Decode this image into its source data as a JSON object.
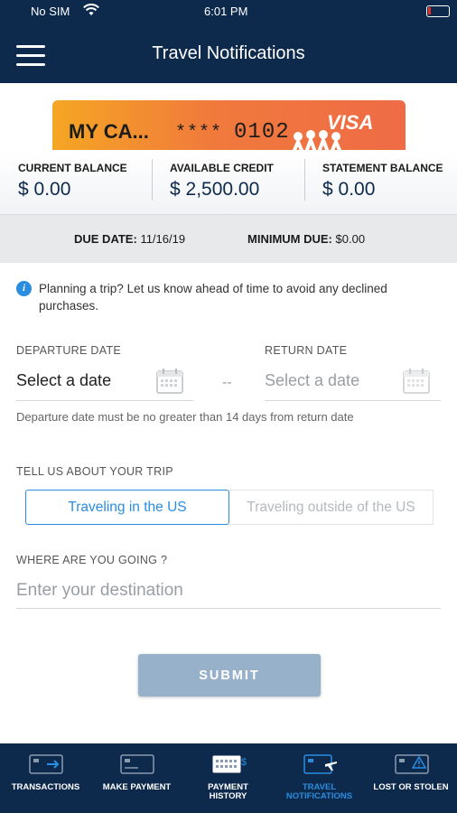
{
  "status_bar": {
    "carrier": "No SIM",
    "time": "6:01 PM"
  },
  "header": {
    "title": "Travel Notifications"
  },
  "card": {
    "name": "MY CA...",
    "masked_number": "****",
    "last4": "0102",
    "network": "VISA"
  },
  "balances": [
    {
      "label": "CURRENT BALANCE",
      "value": "$ 0.00"
    },
    {
      "label": "AVAILABLE CREDIT",
      "value": "$ 2,500.00"
    },
    {
      "label": "STATEMENT BALANCE",
      "value": "$ 0.00"
    }
  ],
  "due": {
    "due_label": "DUE DATE:",
    "due_value": "11/16/19",
    "min_label": "MINIMUM DUE:",
    "min_value": "$0.00"
  },
  "info_text": "Planning a trip? Let us know ahead of time to avoid any declined purchases.",
  "dates": {
    "departure_label": "DEPARTURE DATE",
    "departure_value": "Select a date",
    "return_label": "RETURN DATE",
    "return_placeholder": "Select a date",
    "separator": "--",
    "hint": "Departure date must be no greater than 14 days from return date"
  },
  "trip": {
    "label": "TELL US ABOUT YOUR TRIP",
    "option_us": "Traveling in the US",
    "option_outside": "Traveling outside of the US",
    "selected": "Traveling in the US"
  },
  "destination": {
    "label": "WHERE ARE YOU GOING ?",
    "placeholder": "Enter your destination",
    "value": ""
  },
  "submit_label": "SUBMIT",
  "tabs": [
    {
      "label": "TRANSACTIONS",
      "icon": "card-arrow-icon"
    },
    {
      "label": "MAKE PAYMENT",
      "icon": "card-icon"
    },
    {
      "label": "PAYMENT\nHISTORY",
      "icon": "calendar-dollar-icon"
    },
    {
      "label": "TRAVEL\nNOTIFICATIONS",
      "icon": "card-plane-icon",
      "active": true
    },
    {
      "label": "LOST OR STOLEN",
      "icon": "card-alert-icon"
    }
  ],
  "colors": {
    "navy": "#0d2a4d",
    "accent": "#2a8de0",
    "submit_disabled": "#97b1cb"
  }
}
